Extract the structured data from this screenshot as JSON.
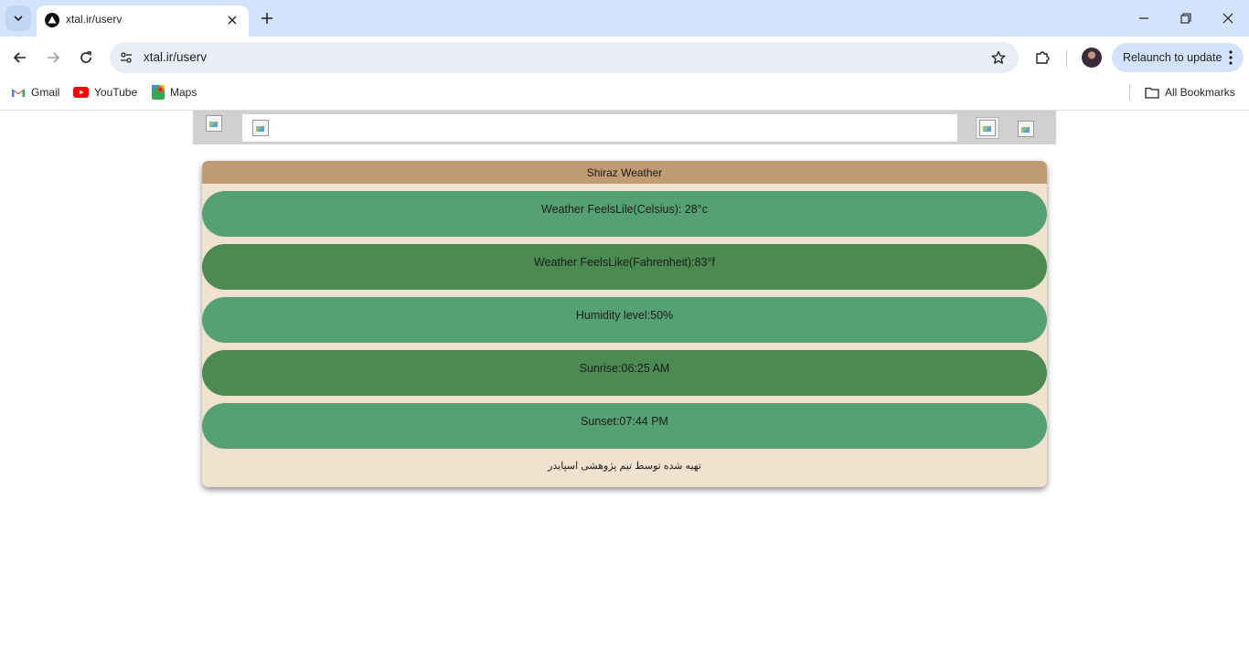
{
  "browser": {
    "tab": {
      "title": "xtal.ir/userv"
    },
    "address": {
      "url": "xtal.ir/userv"
    },
    "relaunch_label": "Relaunch to update",
    "bookmarks": [
      {
        "label": "Gmail",
        "icon": "gmail-icon"
      },
      {
        "label": "YouTube",
        "icon": "youtube-icon"
      },
      {
        "label": "Maps",
        "icon": "maps-icon"
      }
    ],
    "all_bookmarks_label": "All Bookmarks"
  },
  "weather": {
    "header": "Shiraz Weather",
    "rows": [
      {
        "text": "Weather FeelsLile(Celsius): 28°c"
      },
      {
        "text": "Weather FeelsLike(Fahrenheit):83°f"
      },
      {
        "text": "Humidity level:50%"
      },
      {
        "text": "Sunrise:06:25 AM"
      },
      {
        "text": "Sunset:07:44 PM"
      }
    ],
    "footer": "تهیه شده توسط تیم پژوهشی اسپایدر"
  },
  "colors": {
    "tabstrip": "#d3e3fd",
    "card_bg": "#f1e1cf",
    "card_header": "#c19c73",
    "row_light": "#56a173",
    "row_dark": "#4b8a50",
    "topbar": "#d0d0d0"
  }
}
